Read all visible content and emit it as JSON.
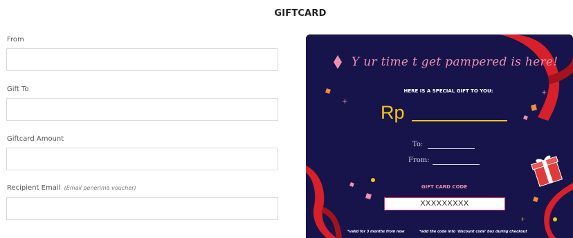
{
  "page": {
    "title": "GIFTCARD"
  },
  "form": {
    "fields": [
      {
        "label": "From",
        "value": ""
      },
      {
        "label": "Gift To",
        "value": ""
      },
      {
        "label": "Giftcard Amount",
        "value": ""
      },
      {
        "label": "Recipient Email",
        "hint": "(Email penerima voucher)",
        "value": ""
      }
    ]
  },
  "card": {
    "tagline": "Y ur time t  get pampered is here!",
    "subtitle": "HERE IS A SPECIAL GIFT TO YOU:",
    "currency": "Rp",
    "to_label": "To:",
    "from_label": "From:",
    "code_label": "GIFT CARD CODE",
    "code_value": "XXXXXXXXX",
    "footnote_left": "*valid for 3 months from now",
    "footnote_right": "*add the code into 'discount code' box during checkout",
    "colors": {
      "background": "#16144a",
      "accent_pink": "#f08fb0",
      "accent_gold": "#f5c518",
      "ribbon_red": "#d8202a"
    },
    "icons": [
      "gift-box-icon",
      "confetti",
      "ribbon"
    ]
  }
}
